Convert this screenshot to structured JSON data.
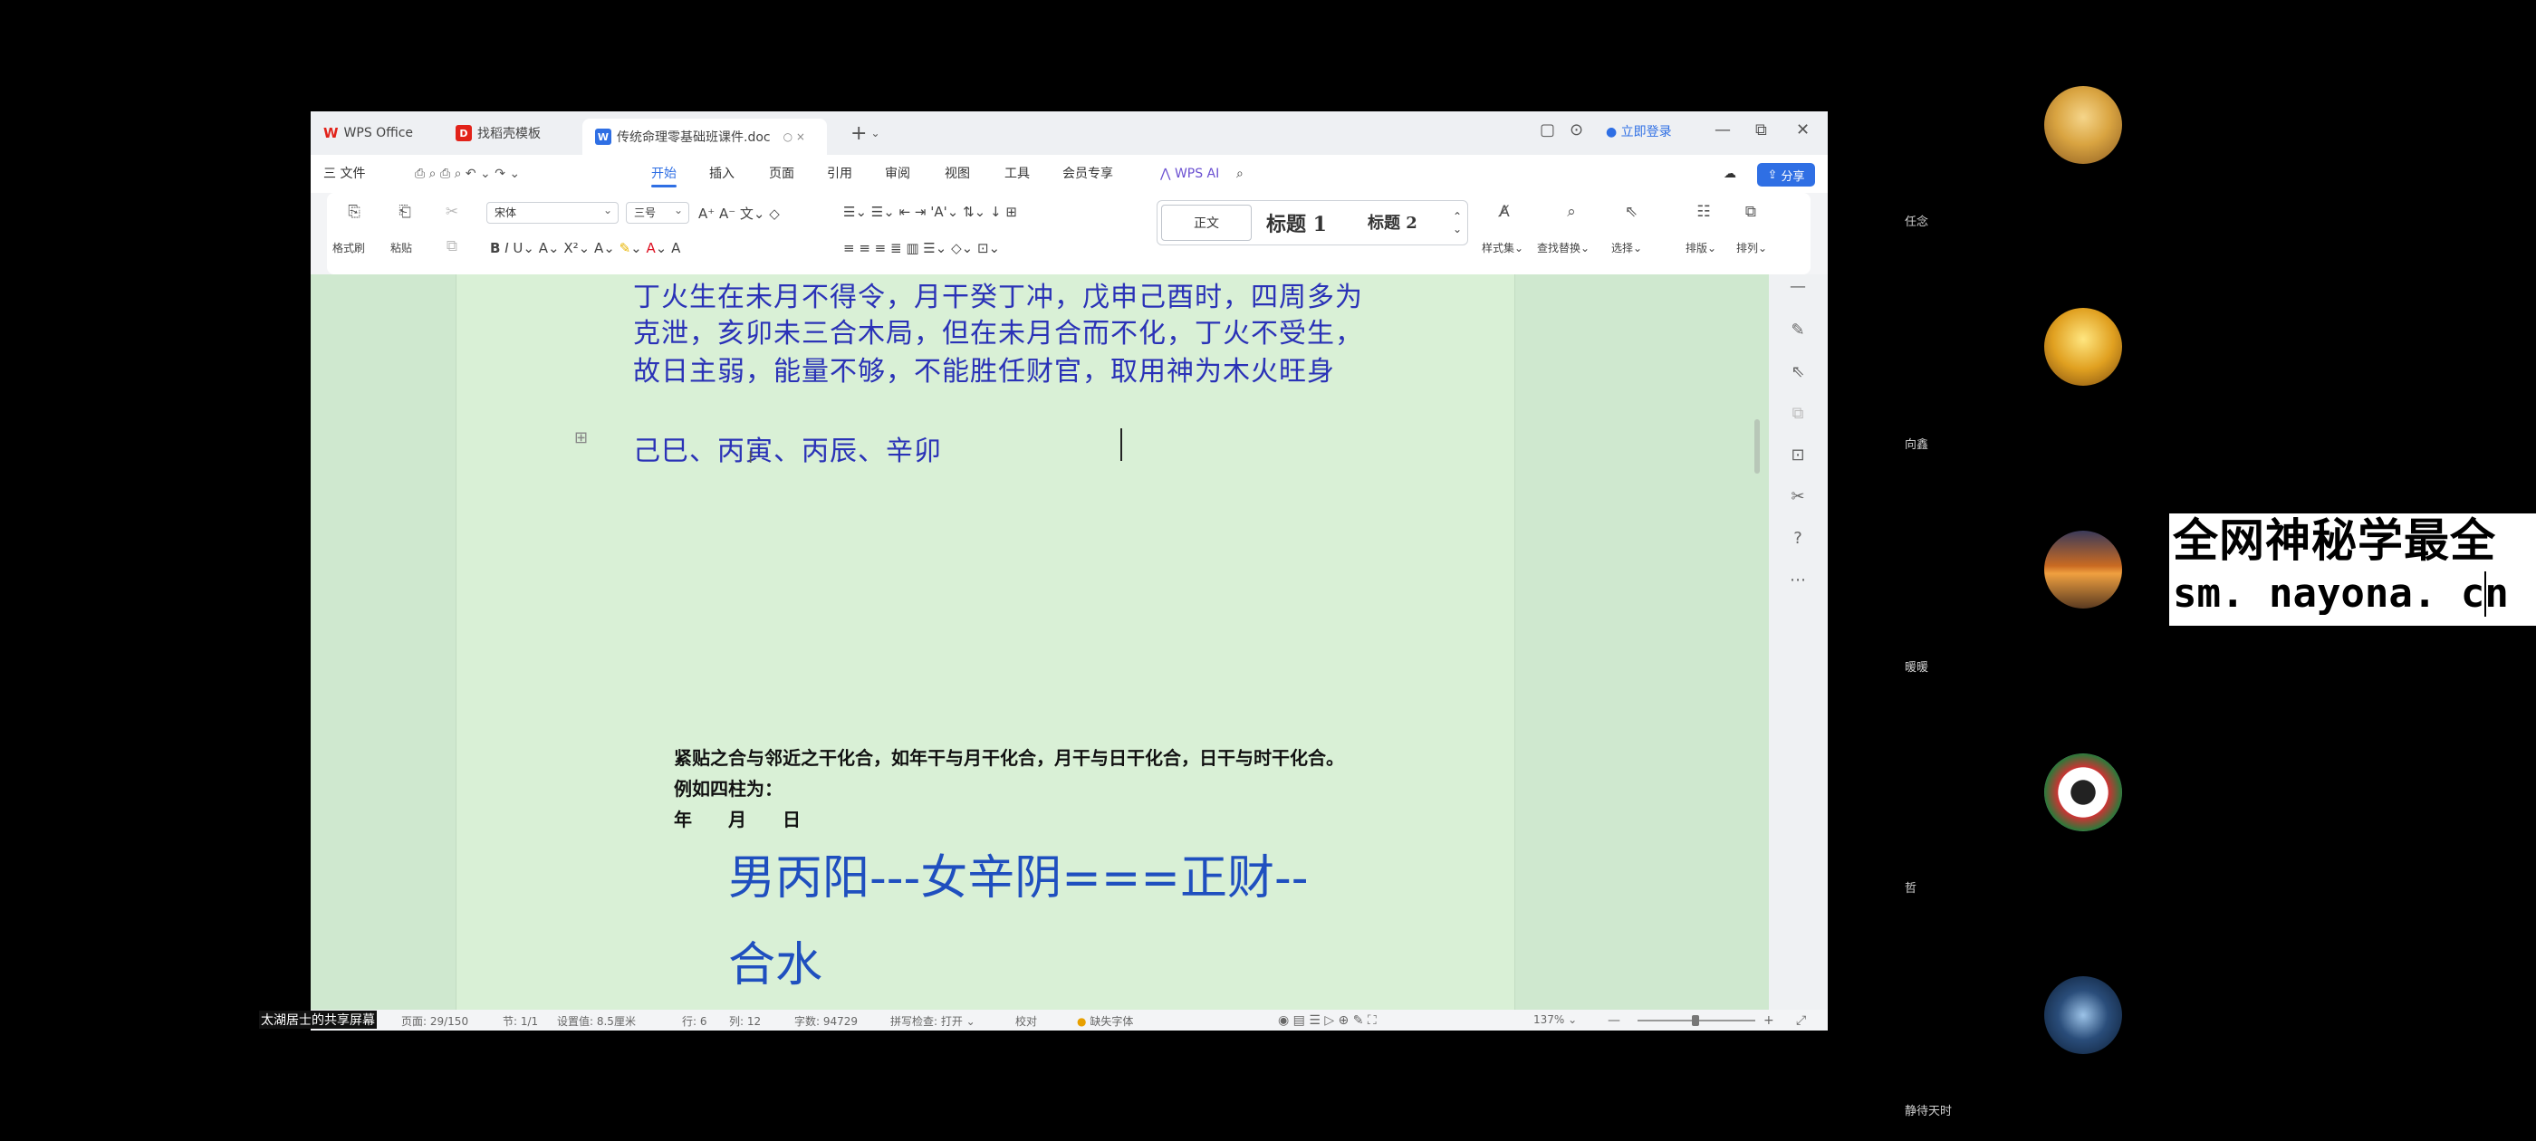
{
  "window": {
    "tabs": [
      {
        "label": "WPS Office",
        "icon": "wps-logo-icon"
      },
      {
        "label": "找稻壳模板",
        "icon": "docer-icon"
      },
      {
        "label": "传统命理零基础班课件.doc",
        "icon": "word-doc-icon",
        "active": true
      }
    ],
    "login_label": "立即登录"
  },
  "menubar": {
    "file_label": "三 文件",
    "items": [
      "开始",
      "插入",
      "页面",
      "引用",
      "审阅",
      "视图",
      "工具",
      "会员专享"
    ],
    "active": "开始",
    "wps_ai_label": "WPS AI",
    "share_label": "分享"
  },
  "ribbon": {
    "format_painter_label": "格式刷",
    "paste_label": "粘贴",
    "font_name": "宋体",
    "font_size": "三号",
    "styles": {
      "normal": "正文",
      "heading1": "标题 1",
      "heading2": "标题 2"
    },
    "style_set_label": "样式集",
    "find_replace_label": "查找替换",
    "select_label": "选择",
    "layout_label": "排版",
    "arrange_label": "排列"
  },
  "document": {
    "paragraphs": [
      "丁火生在未月不得令，月干癸丁冲，戊申己酉时，四周多为",
      "克泄，亥卯未三合木局，但在未月合而不化，丁火不受生，",
      "故日主弱，能量不够，不能胜任财官，取用神为木火旺身"
    ],
    "pillars": "己巳、丙寅、丙辰、辛卯",
    "small_lines": [
      "紧贴之合与邻近之干化合，如年干与月干化合，月干与日干化合，日干与时干化合。",
      "例如四柱为：",
      "年　　月　　日"
    ],
    "big_lines": [
      "男丙阳---女辛阴===正财--",
      "合水"
    ]
  },
  "statusbar": {
    "page": "页面: 29/150",
    "section": "节: 1/1",
    "position": "设置值: 8.5厘米",
    "row": "行: 6",
    "col": "列: 12",
    "word_count": "字数: 94729",
    "spell_check": "拼写检查: 打开",
    "proofread": "校对",
    "missing_font": "缺失字体",
    "zoom": "137%"
  },
  "share_label": "太湖居士的共享屏幕",
  "participants": [
    {
      "name": "任念",
      "color": "#d9a441"
    },
    {
      "name": "向鑫",
      "color": "#e0a020"
    },
    {
      "name": "暖暖",
      "color": "#c96a22"
    },
    {
      "name": "哲",
      "color": "#cfd8cf"
    },
    {
      "name": "静待天时",
      "color": "#2a4d7a"
    }
  ],
  "watermark": {
    "line1": "全网神秘学最全",
    "line2": "sm. nayona. cn"
  }
}
